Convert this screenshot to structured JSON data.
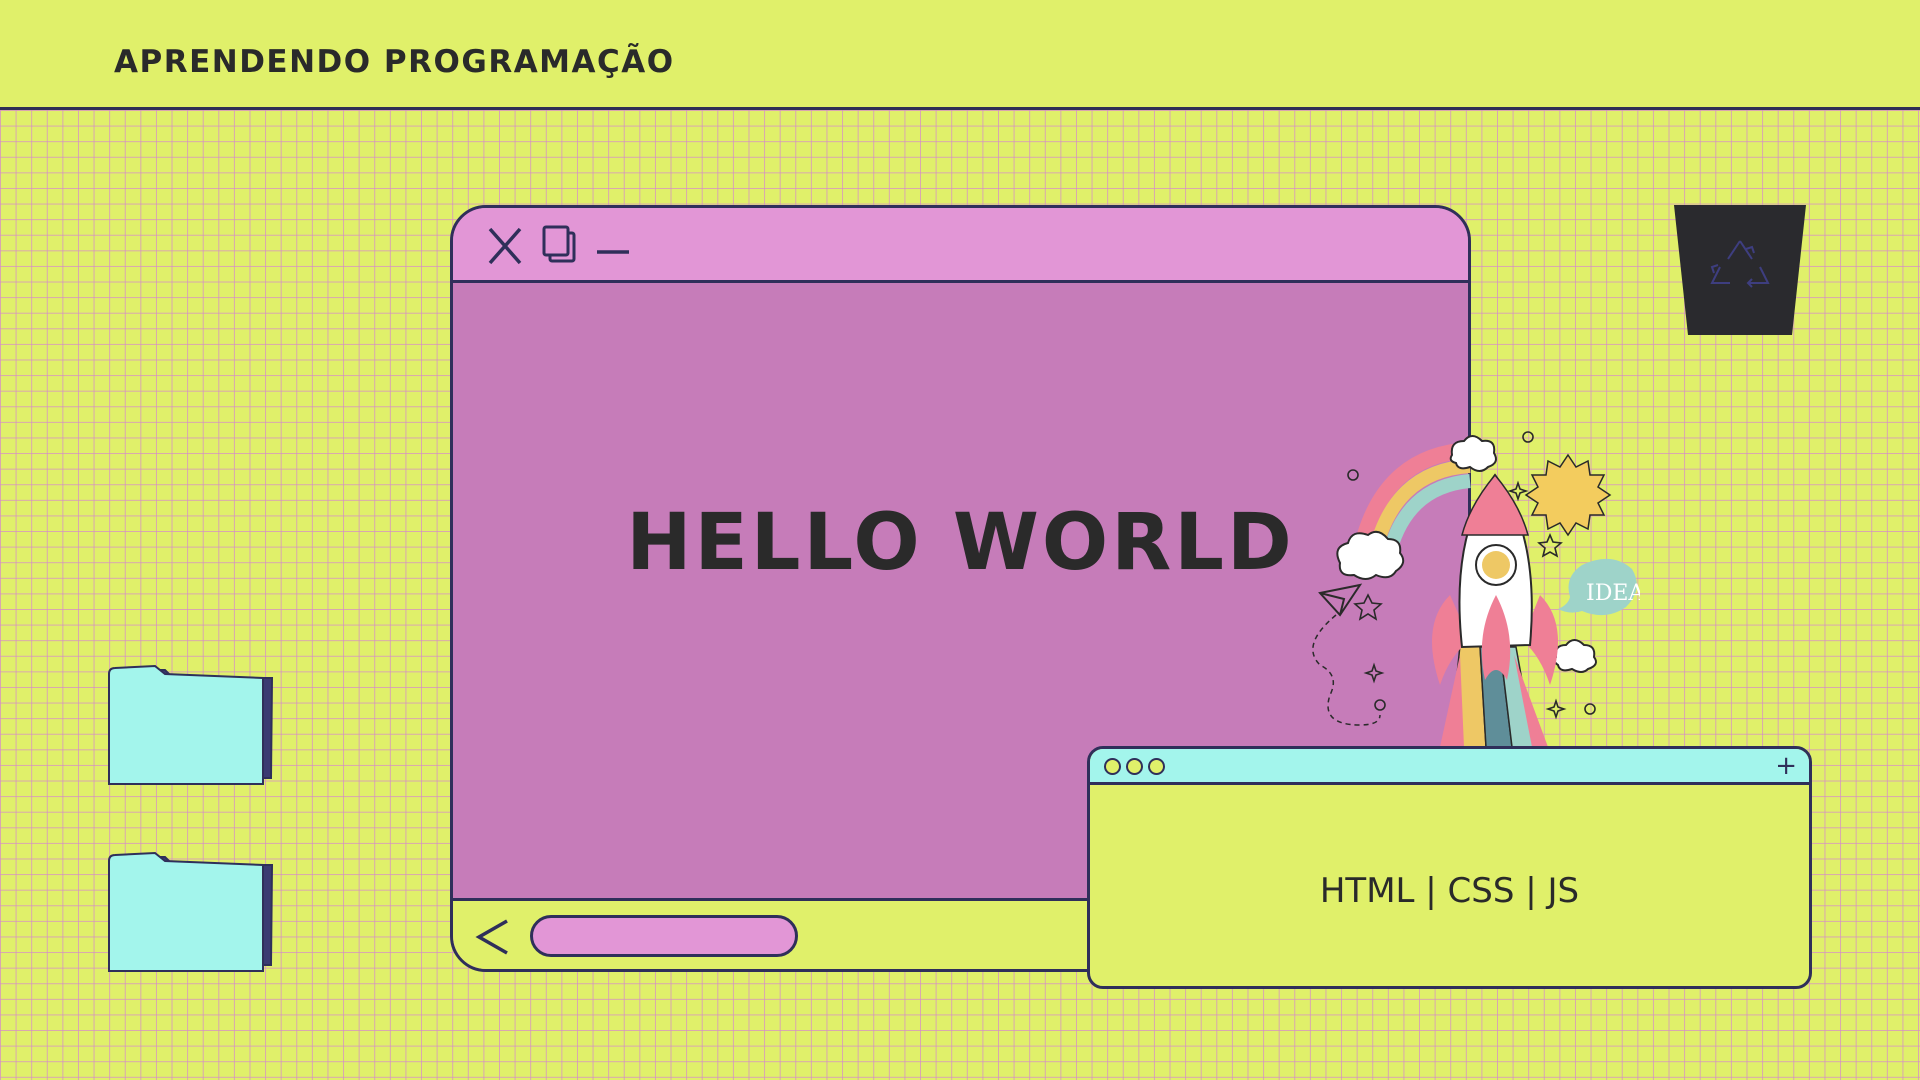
{
  "header": {
    "title": "APRENDENDO PROGRAMAÇÃO"
  },
  "main_window": {
    "heading": "HELLO WORLD",
    "controls": [
      "close-icon",
      "restore-icon",
      "minimize-icon"
    ],
    "back_icon": "chevron-left-icon"
  },
  "small_window": {
    "text": "HTML | CSS | JS",
    "add_icon": "plus-icon",
    "add_label": "+"
  },
  "illustration": {
    "bubble_text": "IDEA"
  },
  "desktop": {
    "icons": [
      "folder-icon",
      "folder-icon",
      "recycle-bin-icon"
    ]
  },
  "colors": {
    "background": "#e0f06a",
    "grid": "#d68cc8",
    "window_titlebar": "#e296d6",
    "window_body": "#c67cb9",
    "outline": "#2f2f5a",
    "accent_cyan": "#a3f5ec",
    "text": "#2a2a2a"
  }
}
